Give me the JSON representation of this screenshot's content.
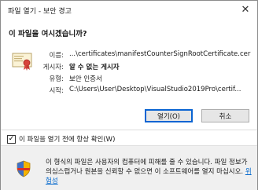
{
  "window": {
    "title": "파일 열기 - 보안 경고",
    "close_glyph": "✕"
  },
  "dialog": {
    "heading": "이 파일을 여시겠습니까?",
    "fields": [
      {
        "label": "이름:",
        "value": "...\\certificates\\manifestCounterSignRootCertificate.cer",
        "bold": false
      },
      {
        "label": "게시자:",
        "value": "알 수 없는 게시자",
        "bold": true
      },
      {
        "label": "유형:",
        "value": "보안 인증서",
        "bold": false
      },
      {
        "label": "시작:",
        "value": "C:\\Users\\User\\Desktop\\VisualStudio2019Pro\\certif...",
        "bold": false
      }
    ],
    "buttons": {
      "open": "열기(O)",
      "cancel": "취소"
    }
  },
  "checkbox": {
    "checked": true,
    "label": "이 파일을 열기 전에 항상 확인(W)"
  },
  "warning": {
    "text": "이 형식의 파일은 사용자의 컴퓨터에 피해를 줄 수 있습니다. 파일 정보가 의심스럽거나 원본을 신뢰할 수 없으면 이 소프트웨어를 열지 마십시오.",
    "link": "위험성"
  },
  "icons": {
    "cert": "certificate-icon",
    "shield": "security-shield-icon",
    "close": "close-icon"
  },
  "colors": {
    "link": "#0066cc",
    "primary_border": "#0a64d2",
    "warning_bg": "#f0f0f0"
  }
}
